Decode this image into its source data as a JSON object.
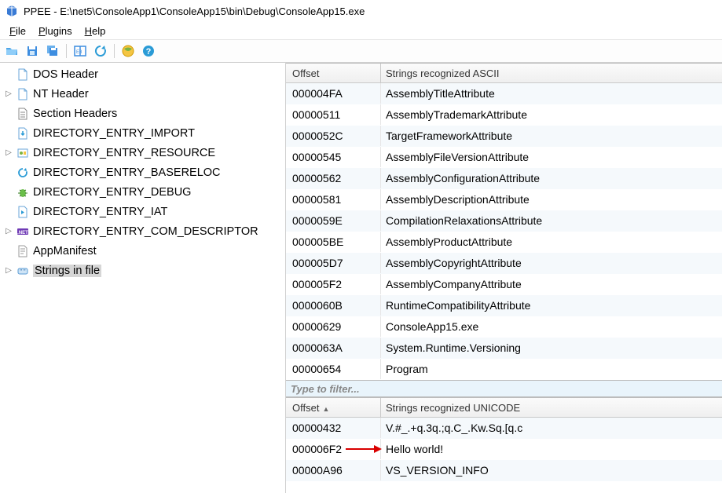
{
  "window": {
    "title": "PPEE - E:\\net5\\ConsoleApp1\\ConsoleApp15\\bin\\Debug\\ConsoleApp15.exe"
  },
  "menu": {
    "file": "File",
    "plugins": "Plugins",
    "help": "Help"
  },
  "toolbar_icons": {
    "open": "folder-open-icon",
    "save": "save-icon",
    "save_all": "save-all-icon",
    "view": "panel-icon",
    "refresh": "refresh-icon",
    "world": "world-icon",
    "help": "help-icon"
  },
  "tree": {
    "items": [
      {
        "label": "DOS Header",
        "icon": "file-icon",
        "expandable": false
      },
      {
        "label": "NT Header",
        "icon": "file-icon",
        "expandable": true
      },
      {
        "label": "Section Headers",
        "icon": "list-icon",
        "expandable": false
      },
      {
        "label": "DIRECTORY_ENTRY_IMPORT",
        "icon": "import-icon",
        "expandable": false
      },
      {
        "label": "DIRECTORY_ENTRY_RESOURCE",
        "icon": "resource-icon",
        "expandable": true
      },
      {
        "label": "DIRECTORY_ENTRY_BASERELOC",
        "icon": "reloc-icon",
        "expandable": false
      },
      {
        "label": "DIRECTORY_ENTRY_DEBUG",
        "icon": "debug-icon",
        "expandable": false
      },
      {
        "label": "DIRECTORY_ENTRY_IAT",
        "icon": "iat-icon",
        "expandable": false
      },
      {
        "label": "DIRECTORY_ENTRY_COM_DESCRIPTOR",
        "icon": "net-icon",
        "expandable": true
      },
      {
        "label": "AppManifest",
        "icon": "manifest-icon",
        "expandable": false
      },
      {
        "label": "Strings in file",
        "icon": "strings-icon",
        "expandable": true,
        "selected": true
      }
    ]
  },
  "ascii_table": {
    "headers": {
      "offset": "Offset",
      "string": "Strings recognized ASCII"
    },
    "rows": [
      {
        "offset": "000004FA",
        "string": "AssemblyTitleAttribute"
      },
      {
        "offset": "00000511",
        "string": "AssemblyTrademarkAttribute"
      },
      {
        "offset": "0000052C",
        "string": "TargetFrameworkAttribute"
      },
      {
        "offset": "00000545",
        "string": "AssemblyFileVersionAttribute"
      },
      {
        "offset": "00000562",
        "string": "AssemblyConfigurationAttribute"
      },
      {
        "offset": "00000581",
        "string": "AssemblyDescriptionAttribute"
      },
      {
        "offset": "0000059E",
        "string": "CompilationRelaxationsAttribute"
      },
      {
        "offset": "000005BE",
        "string": "AssemblyProductAttribute"
      },
      {
        "offset": "000005D7",
        "string": "AssemblyCopyrightAttribute"
      },
      {
        "offset": "000005F2",
        "string": "AssemblyCompanyAttribute"
      },
      {
        "offset": "0000060B",
        "string": "RuntimeCompatibilityAttribute"
      },
      {
        "offset": "00000629",
        "string": "ConsoleApp15.exe"
      },
      {
        "offset": "0000063A",
        "string": "System.Runtime.Versioning"
      },
      {
        "offset": "00000654",
        "string": "Program"
      }
    ]
  },
  "filter": {
    "placeholder": "Type to filter..."
  },
  "unicode_table": {
    "headers": {
      "offset": "Offset",
      "string": "Strings recognized UNICODE"
    },
    "rows": [
      {
        "offset": "00000432",
        "string": "V.#_.+q.3q.;q.C_.Kw.Sq.[q.c"
      },
      {
        "offset": "000006F2",
        "string": "Hello world!"
      },
      {
        "offset": "00000A96",
        "string": "VS_VERSION_INFO"
      }
    ]
  },
  "annotation": {
    "arrow_target_row": 1
  }
}
